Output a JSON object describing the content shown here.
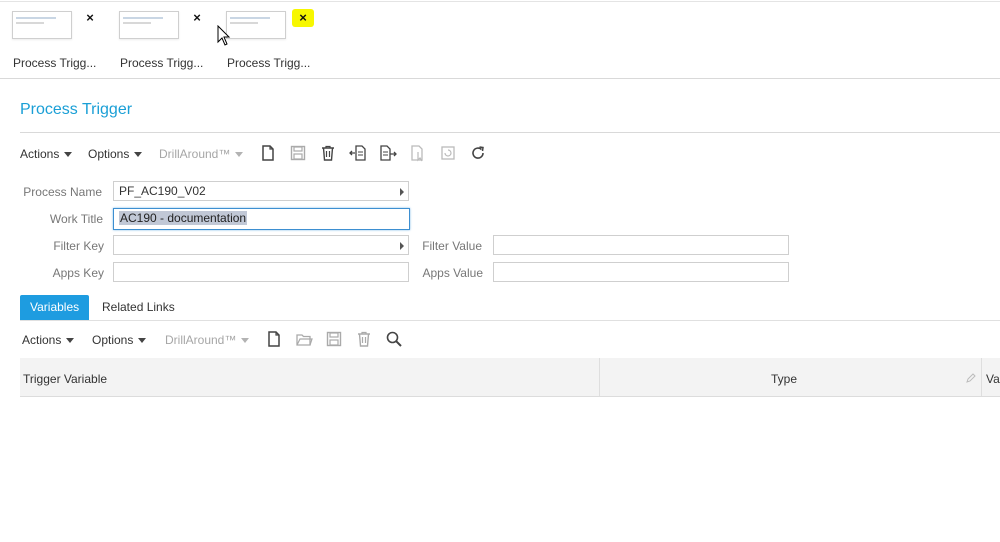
{
  "thumbnails": [
    {
      "label": "Process Trigg...",
      "close": "×"
    },
    {
      "label": "Process Trigg...",
      "close": "×"
    },
    {
      "label": "Process Trigg...",
      "close": "×"
    }
  ],
  "page_title": "Process Trigger",
  "toolbar": {
    "actions": "Actions",
    "options": "Options",
    "drillaround": "DrillAround™"
  },
  "form": {
    "process_name_label": "Process Name",
    "process_name_value": "PF_AC190_V02",
    "work_title_label": "Work Title",
    "work_title_value": "AC190 - documentation",
    "filter_key_label": "Filter Key",
    "filter_key_value": "",
    "filter_value_label": "Filter Value",
    "filter_value_value": "",
    "apps_key_label": "Apps Key",
    "apps_key_value": "",
    "apps_value_label": "Apps Value",
    "apps_value_value": ""
  },
  "tabs": [
    "Variables",
    "Related Links"
  ],
  "sub_toolbar": {
    "actions": "Actions",
    "options": "Options",
    "drillaround": "DrillAround™"
  },
  "grid": {
    "columns": [
      "Trigger Variable",
      "Type",
      "Va"
    ]
  },
  "colors": {
    "accent": "#1a9fd6",
    "tab_active": "#1e9ce0",
    "highlight": "#f7f700"
  }
}
